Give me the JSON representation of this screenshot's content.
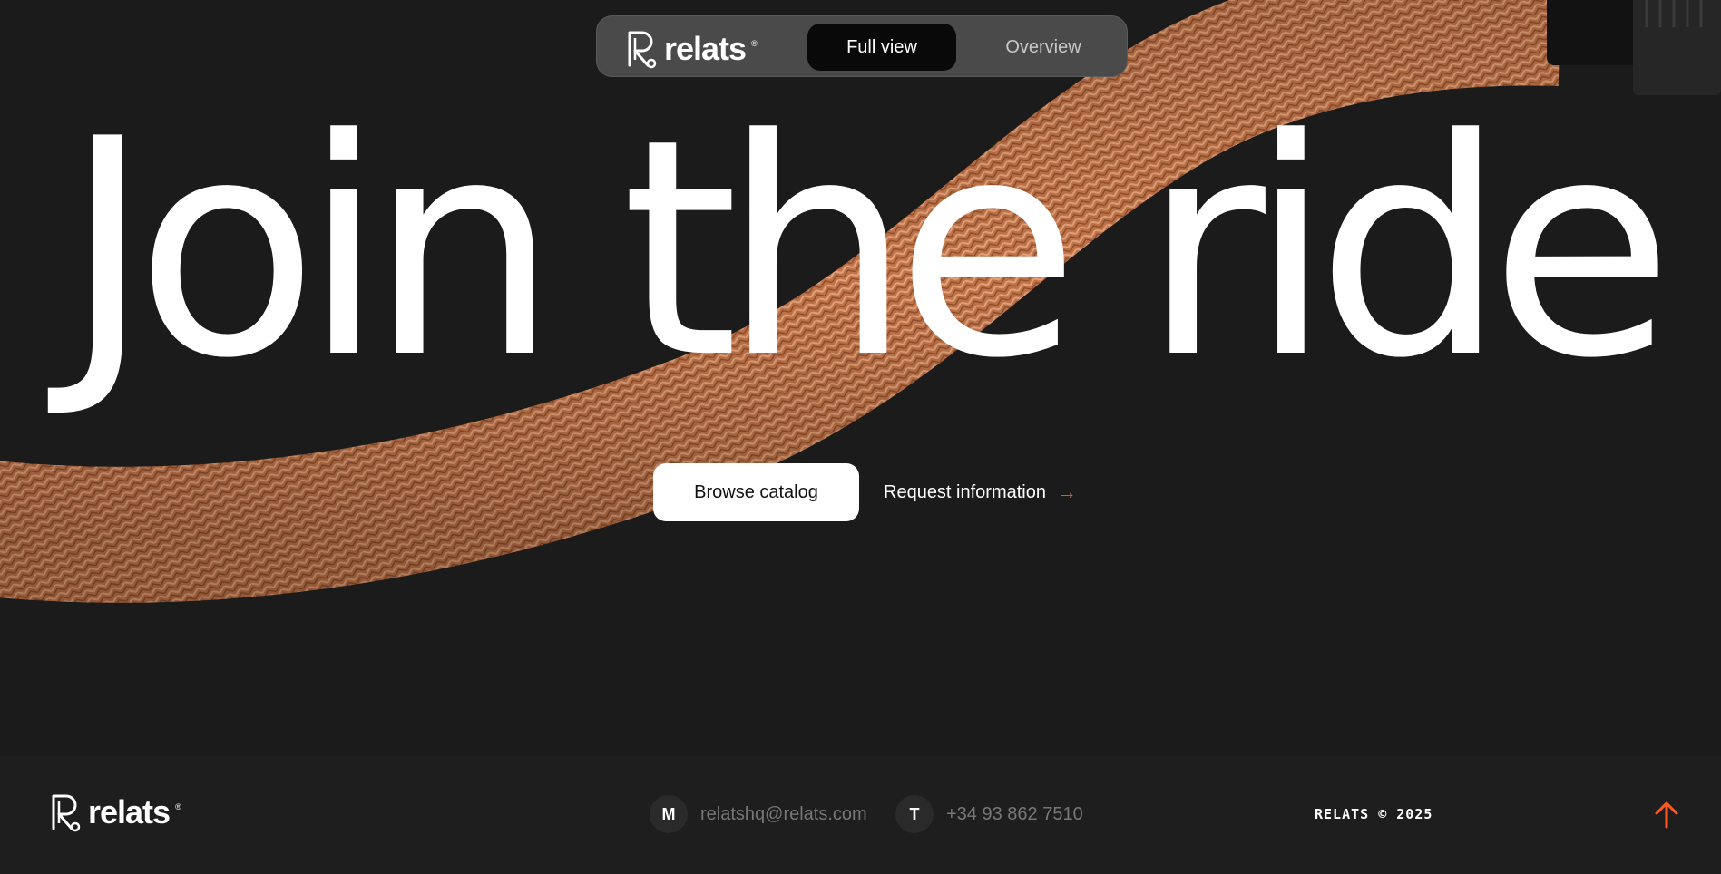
{
  "nav": {
    "brand": "relats",
    "reg_mark": "®",
    "tabs": [
      {
        "label": "Full view",
        "active": true
      },
      {
        "label": "Overview",
        "active": false
      }
    ]
  },
  "hero": {
    "headline": "Join the ride",
    "primary_cta": "Browse catalog",
    "secondary_cta": "Request information",
    "secondary_icon": "arrow-right-icon"
  },
  "footer": {
    "brand": "relats",
    "reg_mark": "®",
    "email_badge": "M",
    "email": "relatshq@relats.com",
    "phone_badge": "T",
    "phone": "+34 93 862 7510",
    "copyright": "RELATS © 2025",
    "scroll_top_icon": "arrow-up-icon"
  },
  "colors": {
    "background": "#1b1b1b",
    "accent": "#ff5a1f",
    "hose": "#c97a4e"
  }
}
